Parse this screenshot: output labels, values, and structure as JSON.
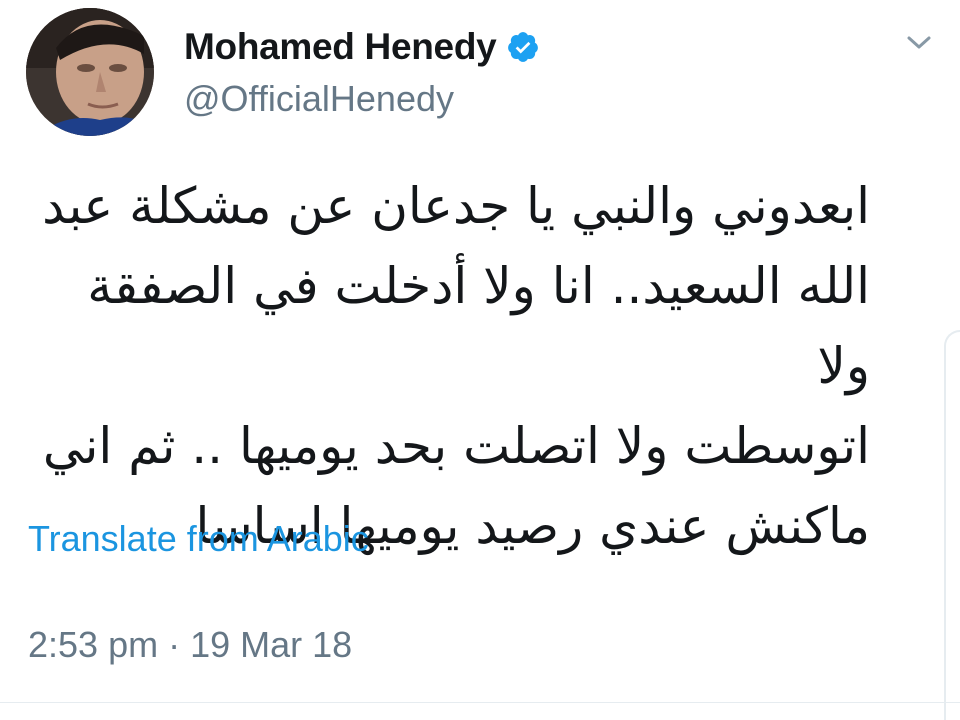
{
  "author": {
    "display_name": "Mohamed Henedy",
    "handle": "@OfficialHenedy",
    "verified": true,
    "avatar_icon": "profile-photo"
  },
  "tweet": {
    "text": "ابعدوني والنبي يا جدعان عن مشكلة عبد الله السعيد.. انا ولا أدخلت في الصفقة ولا اتوسطت ولا اتصلت بحد يوميها .. ثم اني ماكنش عندي رصيد يوميها اساسا",
    "lines": [
      "ابعدوني والنبي يا جدعان عن مشكلة عبد",
      "الله السعيد.. انا ولا أدخلت في الصفقة ولا",
      "اتوسطت ولا اتصلت بحد يوميها .. ثم اني",
      "ماكنش عندي رصيد يوميها اساسا"
    ],
    "translate_label": "Translate from Arabic",
    "timestamp": "2:53 pm · 19 Mar 18"
  },
  "icons": {
    "menu": "chevron-down-icon",
    "verified": "verified-badge-icon"
  },
  "colors": {
    "link": "#1b95e0",
    "muted": "#657786",
    "text": "#14171a",
    "verified": "#1da1f2",
    "divider": "#e6ecf0"
  }
}
